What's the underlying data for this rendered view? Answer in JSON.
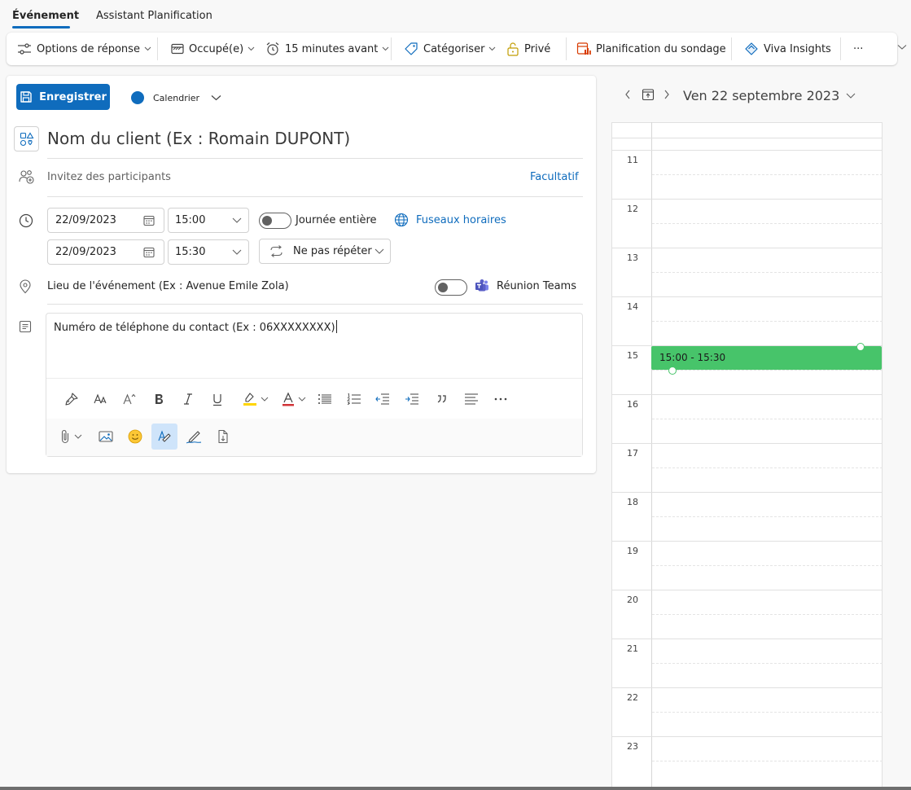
{
  "tabs": [
    {
      "label": "Événement",
      "active": true
    },
    {
      "label": "Assistant Planification",
      "active": false
    }
  ],
  "ribbon": {
    "response_options": "Options de réponse",
    "status": "Occupé(e)",
    "reminder": "15 minutes avant",
    "categorize": "Catégoriser",
    "private": "Privé",
    "poll": "Planification du sondage",
    "viva": "Viva Insights",
    "more": "···"
  },
  "form": {
    "save_label": "Enregistrer",
    "calendar_label": "Calendrier",
    "title": "Nom du client (Ex : Romain DUPONT)",
    "attendees_placeholder": "Invitez des participants",
    "optional_label": "Facultatif",
    "start_date": "22/09/2023",
    "start_time": "15:00",
    "end_date": "22/09/2023",
    "end_time": "15:30",
    "all_day_label": "Journée entière",
    "all_day_on": false,
    "timezones_label": "Fuseaux horaires",
    "repeat_label": "Ne pas répéter",
    "location": "Lieu de l'événement (Ex : Avenue Emile Zola)",
    "teams_label": "Réunion Teams",
    "teams_on": false,
    "body": "Numéro de téléphone du contact (Ex : 06XXXXXXXX)"
  },
  "calendar": {
    "date_label": "Ven 22 septembre 2023",
    "hours": [
      "11",
      "12",
      "13",
      "14",
      "15",
      "16",
      "17",
      "18",
      "19",
      "20",
      "21",
      "22",
      "23"
    ],
    "event_label": "15:00 - 15:30"
  },
  "colors": {
    "accent": "#0f6cbd",
    "event": "#47c46a",
    "poll_icon": "#d83b01",
    "teams": "#5b5fc7",
    "lock": "#c19c00"
  }
}
